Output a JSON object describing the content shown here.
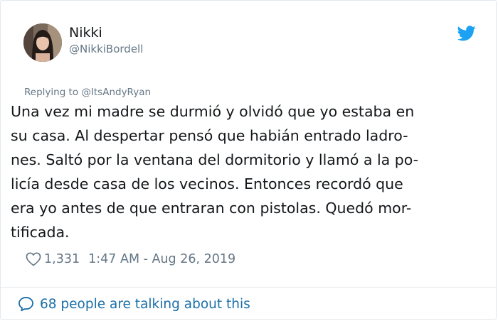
{
  "user": {
    "display_name": "Nikki",
    "username": "@NikkiBordell"
  },
  "reply": {
    "text": "Replying to @ItsAndyRyan"
  },
  "tweet": {
    "lines": [
      "Una vez mi madre se durmió y olvidó que yo estaba en",
      "su casa. Al despertar pensó que habián entrado ladro-",
      "nes. Saltó por la ventana del dormitorio y llamó a la po-",
      "licía desde casa de los vecinos. Entonces recordó que",
      "era yo antes de que entraran con pistolas. Quedó mor-",
      "tificada."
    ]
  },
  "meta": {
    "likes": "1,331",
    "timestamp": "1:47 AM - Aug 26, 2019"
  },
  "footer": {
    "talking": "68 people are talking about this"
  },
  "icons": {
    "brand": "twitter-bird-icon",
    "like": "heart-outline-icon",
    "talking": "speech-bubble-icon"
  },
  "colors": {
    "twitter_blue": "#1da1f2",
    "link_blue": "#1b6fa8",
    "secondary_text": "#657786",
    "primary_text": "#14171a"
  }
}
